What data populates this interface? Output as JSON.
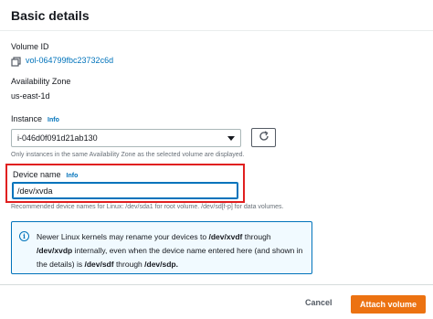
{
  "panel": {
    "title": "Basic details"
  },
  "volume": {
    "label": "Volume ID",
    "id": "vol-064799fbc23732c6d"
  },
  "availability": {
    "label": "Availability Zone",
    "value": "us-east-1d"
  },
  "instance": {
    "label": "Instance",
    "info": "Info",
    "selected": "i-046d0f091d21ab130",
    "help": "Only instances in the same Availability Zone as the selected volume are displayed."
  },
  "device": {
    "label": "Device name",
    "info": "Info",
    "value": "/dev/xvda",
    "help": "Recommended device names for Linux: /dev/sda1 for root volume. /dev/sd[f-p] for data volumes."
  },
  "alert": {
    "line1_prefix": "Newer Linux kernels may rename your devices to ",
    "line1_bold": "/dev/xvdf",
    "line1_suffix": " through",
    "line2_bold": "/dev/xvdp",
    "line2_suffix": " internally, even when the device name entered here (and shown in",
    "line3_prefix": "the details) is ",
    "line3_bold1": "/dev/sdf",
    "line3_mid": " through ",
    "line3_bold2": "/dev/sdp."
  },
  "footer": {
    "cancel_label": "Cancel",
    "attach_label": "Attach volume"
  },
  "colors": {
    "accent": "#0073bb",
    "primary_button": "#ec7211",
    "highlight_border": "#e02020"
  },
  "icons": {
    "copy": "copy-icon",
    "refresh": "refresh-icon",
    "info": "info-circle-icon",
    "caret": "caret-down-icon"
  }
}
